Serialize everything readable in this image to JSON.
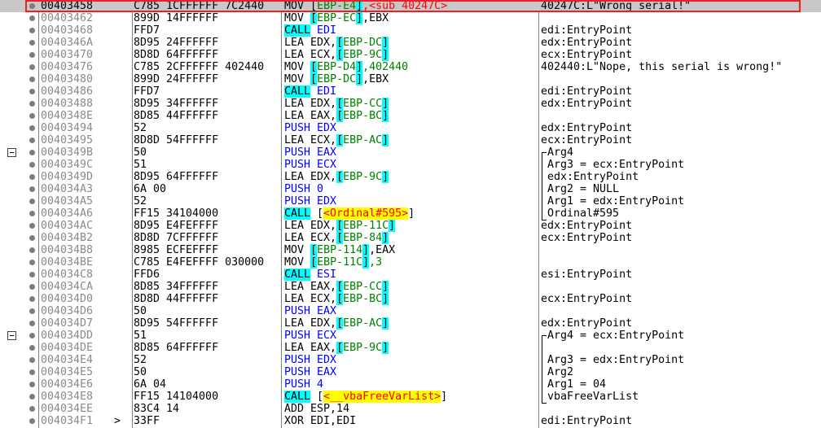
{
  "rows": [
    {
      "addr": "00403458",
      "bytes": "C785 1CFFFFFF 7C2440",
      "op": "MOV",
      "a": [
        {
          "t": "[",
          "c": "br"
        },
        {
          "t": "EBP-E4",
          "c": "ptr"
        },
        {
          "t": "]",
          "c": "sq"
        },
        {
          "t": ",<sub_40247C>",
          "c": "lblref"
        }
      ],
      "cmt": "40247C:L\"Wrong serial!\"",
      "selected": true
    },
    {
      "addr": "00403462",
      "bytes": "899D 14FFFFFF",
      "op": "MOV",
      "a": [
        {
          "t": "[",
          "c": "sq"
        },
        {
          "t": "EBP-EC",
          "c": "ptr"
        },
        {
          "t": "]",
          "c": "sq"
        },
        {
          "t": ",EBX",
          "c": ""
        }
      ],
      "cmt": ""
    },
    {
      "addr": "00403468",
      "bytes": "FFD7",
      "op": "CALL",
      "opc": "call",
      "a": [
        {
          "t": " EDI",
          "c": "push"
        }
      ],
      "cmt": "edi:EntryPoint"
    },
    {
      "addr": "0040346A",
      "bytes": "8D95 24FFFFFF",
      "op": "LEA",
      "a": [
        {
          "t": " EDX,",
          "c": ""
        },
        {
          "t": "[",
          "c": "sq"
        },
        {
          "t": "EBP-DC",
          "c": "ptr"
        },
        {
          "t": "]",
          "c": "sq"
        }
      ],
      "cmt": "edx:EntryPoint"
    },
    {
      "addr": "00403470",
      "bytes": "8D8D 64FFFFFF",
      "op": "LEA",
      "a": [
        {
          "t": " ECX,",
          "c": ""
        },
        {
          "t": "[",
          "c": "sq"
        },
        {
          "t": "EBP-9C",
          "c": "ptr"
        },
        {
          "t": "]",
          "c": "sq"
        }
      ],
      "cmt": "ecx:EntryPoint"
    },
    {
      "addr": "00403476",
      "bytes": "C785 2CFFFFFF 402440",
      "op": "MOV",
      "a": [
        {
          "t": " ",
          "c": ""
        },
        {
          "t": "[",
          "c": "sq"
        },
        {
          "t": "EBP-D4",
          "c": "ptr"
        },
        {
          "t": "]",
          "c": "sq"
        },
        {
          "t": ",402440",
          "c": "ptr"
        }
      ],
      "cmt": "402440:L\"Nope, this serial is wrong!\""
    },
    {
      "addr": "00403480",
      "bytes": "899D 24FFFFFF",
      "op": "MOV",
      "a": [
        {
          "t": " ",
          "c": ""
        },
        {
          "t": "[",
          "c": "sq"
        },
        {
          "t": "EBP-DC",
          "c": "ptr"
        },
        {
          "t": "]",
          "c": "sq"
        },
        {
          "t": ",EBX",
          "c": ""
        }
      ],
      "cmt": ""
    },
    {
      "addr": "00403486",
      "bytes": "FFD7",
      "op": "CALL",
      "opc": "call",
      "a": [
        {
          "t": " EDI",
          "c": "push"
        }
      ],
      "cmt": "edi:EntryPoint"
    },
    {
      "addr": "00403488",
      "bytes": "8D95 34FFFFFF",
      "op": "LEA",
      "a": [
        {
          "t": " EDX,",
          "c": ""
        },
        {
          "t": "[",
          "c": "sq"
        },
        {
          "t": "EBP-CC",
          "c": "ptr"
        },
        {
          "t": "]",
          "c": "sq"
        }
      ],
      "cmt": "edx:EntryPoint"
    },
    {
      "addr": "0040348E",
      "bytes": "8D85 44FFFFFF",
      "op": "LEA",
      "a": [
        {
          "t": " EAX,",
          "c": ""
        },
        {
          "t": "[",
          "c": "sq"
        },
        {
          "t": "EBP-BC",
          "c": "ptr"
        },
        {
          "t": "]",
          "c": "sq"
        }
      ],
      "cmt": ""
    },
    {
      "addr": "00403494",
      "bytes": "52",
      "op": "PUSH",
      "opc": "push",
      "a": [
        {
          "t": " EDX",
          "c": "push"
        }
      ],
      "cmt": "edx:EntryPoint"
    },
    {
      "addr": "00403495",
      "bytes": "8D8D 54FFFFFF",
      "op": "LEA",
      "a": [
        {
          "t": " ECX,",
          "c": ""
        },
        {
          "t": "[",
          "c": "sq"
        },
        {
          "t": "EBP-AC",
          "c": "ptr"
        },
        {
          "t": "]",
          "c": "sq"
        }
      ],
      "cmt": "ecx:EntryPoint"
    },
    {
      "addr": "0040349B",
      "bytes": "50",
      "op": "PUSH",
      "opc": "push",
      "a": [
        {
          "t": " EAX",
          "c": "push"
        }
      ],
      "cmt": "Arg4",
      "fold": true,
      "indent": true
    },
    {
      "addr": "0040349C",
      "bytes": "51",
      "op": "PUSH",
      "opc": "push",
      "a": [
        {
          "t": " ECX",
          "c": "push"
        }
      ],
      "cmt": "Arg3 = ecx:EntryPoint",
      "indent": true
    },
    {
      "addr": "0040349D",
      "bytes": "8D95 64FFFFFF",
      "op": "LEA",
      "a": [
        {
          "t": " EDX,",
          "c": ""
        },
        {
          "t": "[",
          "c": "sq"
        },
        {
          "t": "EBP-9C",
          "c": "ptr"
        },
        {
          "t": "]",
          "c": "sq"
        }
      ],
      "cmt": "edx:EntryPoint",
      "indent": true
    },
    {
      "addr": "004034A3",
      "bytes": "6A 00",
      "op": "PUSH",
      "opc": "push",
      "a": [
        {
          "t": " 0",
          "c": "push"
        }
      ],
      "cmt": "Arg2 = NULL",
      "indent": true
    },
    {
      "addr": "004034A5",
      "bytes": "52",
      "op": "PUSH",
      "opc": "push",
      "a": [
        {
          "t": " EDX",
          "c": "push"
        }
      ],
      "cmt": "Arg1 = edx:EntryPoint",
      "indent": true
    },
    {
      "addr": "004034A6",
      "bytes": "FF15 34104000",
      "op": "CALL",
      "opc": "call",
      "a": [
        {
          "t": " [",
          "c": ""
        },
        {
          "t": "<Ordinal#595>",
          "c": "fn"
        },
        {
          "t": "]",
          "c": ""
        }
      ],
      "cmt": "Ordinal#595",
      "indent": true
    },
    {
      "addr": "004034AC",
      "bytes": "8D95 E4FEFFFF",
      "op": "LEA",
      "a": [
        {
          "t": " EDX,",
          "c": ""
        },
        {
          "t": "[",
          "c": "sq"
        },
        {
          "t": "EBP-11C",
          "c": "ptr"
        },
        {
          "t": "]",
          "c": "sq"
        }
      ],
      "cmt": "edx:EntryPoint"
    },
    {
      "addr": "004034B2",
      "bytes": "8D8D 7CFFFFFF",
      "op": "LEA",
      "a": [
        {
          "t": " ECX,",
          "c": ""
        },
        {
          "t": "[",
          "c": "sq"
        },
        {
          "t": "EBP-84",
          "c": "ptr"
        },
        {
          "t": "]",
          "c": "sq"
        }
      ],
      "cmt": "ecx:EntryPoint"
    },
    {
      "addr": "004034B8",
      "bytes": "8985 ECFEFFFF",
      "op": "MOV",
      "a": [
        {
          "t": " ",
          "c": ""
        },
        {
          "t": "[",
          "c": "sq"
        },
        {
          "t": "EBP-114",
          "c": "ptr"
        },
        {
          "t": "]",
          "c": "sq"
        },
        {
          "t": ",EAX",
          "c": ""
        }
      ],
      "cmt": ""
    },
    {
      "addr": "004034BE",
      "bytes": "C785 E4FEFFFF 030000",
      "op": "MOV",
      "a": [
        {
          "t": " ",
          "c": ""
        },
        {
          "t": "[",
          "c": "sq"
        },
        {
          "t": "EBP-11C",
          "c": "ptr"
        },
        {
          "t": "]",
          "c": "sq"
        },
        {
          "t": ",3",
          "c": "ptr"
        }
      ],
      "cmt": ""
    },
    {
      "addr": "004034C8",
      "bytes": "FFD6",
      "op": "CALL",
      "opc": "call",
      "a": [
        {
          "t": " ESI",
          "c": "push"
        }
      ],
      "cmt": "esi:EntryPoint"
    },
    {
      "addr": "004034CA",
      "bytes": "8D85 34FFFFFF",
      "op": "LEA",
      "a": [
        {
          "t": " EAX,",
          "c": ""
        },
        {
          "t": "[",
          "c": "sq"
        },
        {
          "t": "EBP-CC",
          "c": "ptr"
        },
        {
          "t": "]",
          "c": "sq"
        }
      ],
      "cmt": ""
    },
    {
      "addr": "004034D0",
      "bytes": "8D8D 44FFFFFF",
      "op": "LEA",
      "a": [
        {
          "t": " ECX,",
          "c": ""
        },
        {
          "t": "[",
          "c": "sq"
        },
        {
          "t": "EBP-BC",
          "c": "ptr"
        },
        {
          "t": "]",
          "c": "sq"
        }
      ],
      "cmt": "ecx:EntryPoint"
    },
    {
      "addr": "004034D6",
      "bytes": "50",
      "op": "PUSH",
      "opc": "push",
      "a": [
        {
          "t": " EAX",
          "c": "push"
        }
      ],
      "cmt": ""
    },
    {
      "addr": "004034D7",
      "bytes": "8D95 54FFFFFF",
      "op": "LEA",
      "a": [
        {
          "t": " EDX,",
          "c": ""
        },
        {
          "t": "[",
          "c": "sq"
        },
        {
          "t": "EBP-AC",
          "c": "ptr"
        },
        {
          "t": "]",
          "c": "sq"
        }
      ],
      "cmt": "edx:EntryPoint"
    },
    {
      "addr": "004034DD",
      "bytes": "51",
      "op": "PUSH",
      "opc": "push",
      "a": [
        {
          "t": " ECX",
          "c": "push"
        }
      ],
      "cmt": "Arg4 = ecx:EntryPoint",
      "fold": true,
      "indent": true
    },
    {
      "addr": "004034DE",
      "bytes": "8D85 64FFFFFF",
      "op": "LEA",
      "a": [
        {
          "t": " EAX,",
          "c": ""
        },
        {
          "t": "[",
          "c": "sq"
        },
        {
          "t": "EBP-9C",
          "c": "ptr"
        },
        {
          "t": "]",
          "c": "sq"
        }
      ],
      "cmt": "",
      "indent": true
    },
    {
      "addr": "004034E4",
      "bytes": "52",
      "op": "PUSH",
      "opc": "push",
      "a": [
        {
          "t": " EDX",
          "c": "push"
        }
      ],
      "cmt": "Arg3 = edx:EntryPoint",
      "indent": true
    },
    {
      "addr": "004034E5",
      "bytes": "50",
      "op": "PUSH",
      "opc": "push",
      "a": [
        {
          "t": " EAX",
          "c": "push"
        }
      ],
      "cmt": "Arg2",
      "indent": true
    },
    {
      "addr": "004034E6",
      "bytes": "6A 04",
      "op": "PUSH",
      "opc": "push",
      "a": [
        {
          "t": " 4",
          "c": "push"
        }
      ],
      "cmt": "Arg1 = 04",
      "indent": true
    },
    {
      "addr": "004034E8",
      "bytes": "FF15 14104000",
      "op": "CALL",
      "opc": "call",
      "a": [
        {
          "t": " [",
          "c": ""
        },
        {
          "t": "<__vbaFreeVarList>",
          "c": "fn"
        },
        {
          "t": "]",
          "c": ""
        }
      ],
      "cmt": "vbaFreeVarList",
      "indent": true
    },
    {
      "addr": "004034EE",
      "bytes": "83C4 14",
      "op": "ADD",
      "a": [
        {
          "t": " ESP,14",
          "c": ""
        }
      ],
      "cmt": ""
    },
    {
      "addr": "004034F1",
      "bytes": "33FF",
      "op": "XOR",
      "a": [
        {
          "t": " EDI,EDI",
          "c": ""
        }
      ],
      "cmt": "edi:EntryPoint",
      "marker": ">"
    }
  ]
}
